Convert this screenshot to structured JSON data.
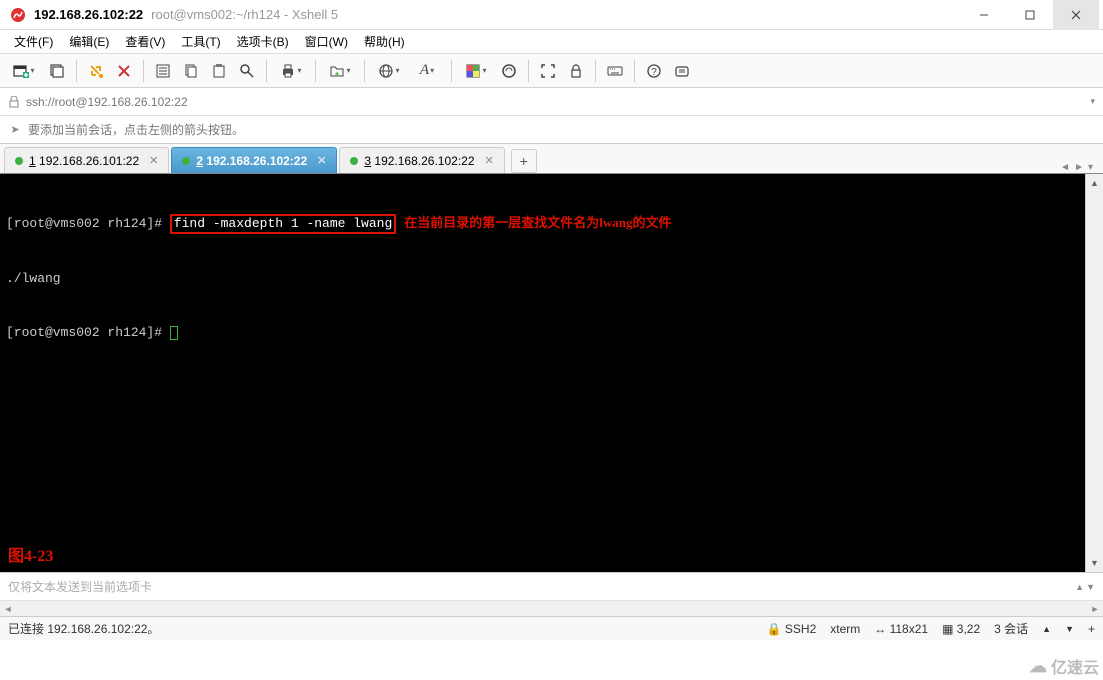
{
  "title": {
    "main": "192.168.26.102:22",
    "sub": "root@vms002:~/rh124 - Xshell 5"
  },
  "menu": {
    "file": "文件(F)",
    "edit": "编辑(E)",
    "view": "查看(V)",
    "tools": "工具(T)",
    "tabs": "选项卡(B)",
    "window": "窗口(W)",
    "help": "帮助(H)"
  },
  "address": {
    "url": "ssh://root@192.168.26.102:22"
  },
  "info": {
    "hint": "要添加当前会话，点击左侧的箭头按钮。"
  },
  "tabs": [
    {
      "num": "1",
      "label": "192.168.26.101:22",
      "active": false
    },
    {
      "num": "2",
      "label": "192.168.26.102:22",
      "active": true
    },
    {
      "num": "3",
      "label": "192.168.26.102:22",
      "active": false
    }
  ],
  "terminal": {
    "line1_prompt": "[root@vms002 rh124]# ",
    "line1_cmd": "find -maxdepth 1 -name lwang",
    "line1_ann": "在当前目录的第一层查找文件名为lwang的文件",
    "line2": "./lwang",
    "line3_prompt": "[root@vms002 rh124]# ",
    "fig": "图4-23"
  },
  "input": {
    "placeholder": "仅将文本发送到当前选项卡"
  },
  "status": {
    "conn": "已连接 192.168.26.102:22。",
    "ssh": "SSH2",
    "term": "xterm",
    "size": "118x21",
    "pos": "3,22",
    "sessions": "3 会话"
  },
  "watermark": "亿速云"
}
